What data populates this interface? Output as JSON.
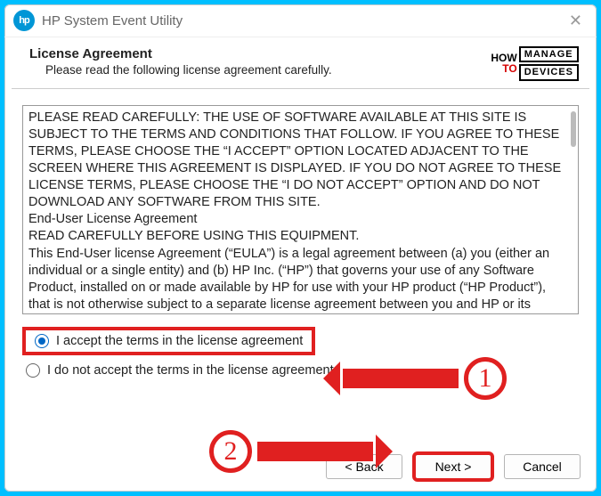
{
  "titlebar": {
    "app_title": "HP System Event Utility",
    "logo_text": "hp"
  },
  "header": {
    "title": "License Agreement",
    "subtitle": "Please read the following license agreement carefully."
  },
  "brand": {
    "how": "HOW",
    "to": "TO",
    "line1": "MANAGE",
    "line2": "DEVICES"
  },
  "eula": {
    "text": "PLEASE READ CAREFULLY: THE USE OF SOFTWARE AVAILABLE AT THIS SITE IS SUBJECT TO THE TERMS AND CONDITIONS THAT FOLLOW. IF YOU AGREE TO THESE TERMS, PLEASE CHOOSE THE “I ACCEPT” OPTION LOCATED ADJACENT TO THE SCREEN WHERE THIS AGREEMENT IS DISPLAYED. IF YOU DO NOT AGREE TO THESE LICENSE TERMS, PLEASE CHOOSE THE “I DO NOT ACCEPT” OPTION AND DO NOT DOWNLOAD ANY SOFTWARE FROM THIS SITE.\nEnd-User License Agreement\nREAD CAREFULLY BEFORE USING THIS EQUIPMENT.\nThis End-User license Agreement (“EULA”) is a legal agreement between (a) you (either an individual or a single entity) and (b) HP Inc. (“HP”) that governs your use of any Software Product, installed on or made available by HP for use with your HP product (“HP Product”), that is not otherwise subject to a separate license agreement between you and HP or its suppliers. Other software may contain a EULA in its online"
  },
  "radios": {
    "accept": "I accept the terms in the license agreement",
    "decline": "I do not accept the terms in the license agreement"
  },
  "buttons": {
    "back": "< Back",
    "next": "Next >",
    "cancel": "Cancel"
  },
  "annotations": {
    "step1": "1",
    "step2": "2"
  }
}
